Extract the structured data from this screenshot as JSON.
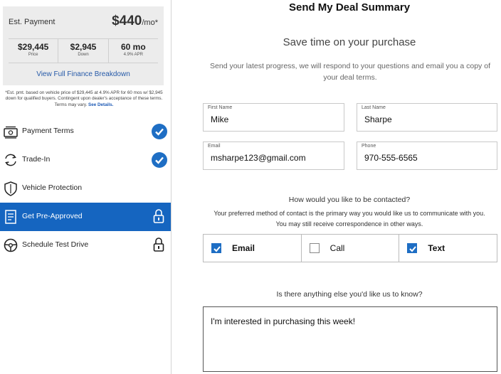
{
  "payment": {
    "est_label": "Est. Payment",
    "amount": "$440",
    "amount_suffix": "/mo*",
    "price_value": "$29,445",
    "price_label": "Price",
    "down_value": "$2,945",
    "down_label": "Down",
    "term_value": "60 mo",
    "term_label": "4.9% APR",
    "breakdown_link": "View Full Finance Breakdown"
  },
  "disclaimer": {
    "text": "*Est. pmt. based on vehicle price of $29,445 at 4.9% APR for 60 mos w/ $2,945 down for qualified buyers. Contingent upon dealer's acceptance of these terms. Terms may vary.",
    "details_link": "See Details."
  },
  "steps": [
    {
      "label": "Payment Terms",
      "status": "complete"
    },
    {
      "label": "Trade-In",
      "status": "complete"
    },
    {
      "label": "Vehicle Protection",
      "status": "none"
    },
    {
      "label": "Get Pre-Approved",
      "status": "locked"
    },
    {
      "label": "Schedule Test Drive",
      "status": "locked"
    }
  ],
  "form": {
    "title": "Send My Deal Summary",
    "subtitle": "Save time on your purchase",
    "intro": "Send your latest progress, we will respond to your questions and email you a copy of your deal terms.",
    "first_name_label": "First Name",
    "first_name_value": "Mike",
    "last_name_label": "Last Name",
    "last_name_value": "Sharpe",
    "email_label": "Email",
    "email_value": "msharpe123@gmail.com",
    "phone_label": "Phone",
    "phone_value": "970-555-6565",
    "contact_question": "How would you like to be contacted?",
    "contact_note_line1": "Your preferred method of contact is the primary way you would like us to communicate with you.",
    "contact_note_line2": "You may still receive correspondence in other ways.",
    "methods": [
      {
        "label": "Email",
        "checked": true
      },
      {
        "label": "Call",
        "checked": false
      },
      {
        "label": "Text",
        "checked": true
      }
    ],
    "anything_question": "Is there anything else you'd like us to know?",
    "message_value": "I'm interested in purchasing this week!"
  },
  "colors": {
    "accent": "#1565c0",
    "check": "#1e6ec4",
    "link": "#2559a8"
  }
}
